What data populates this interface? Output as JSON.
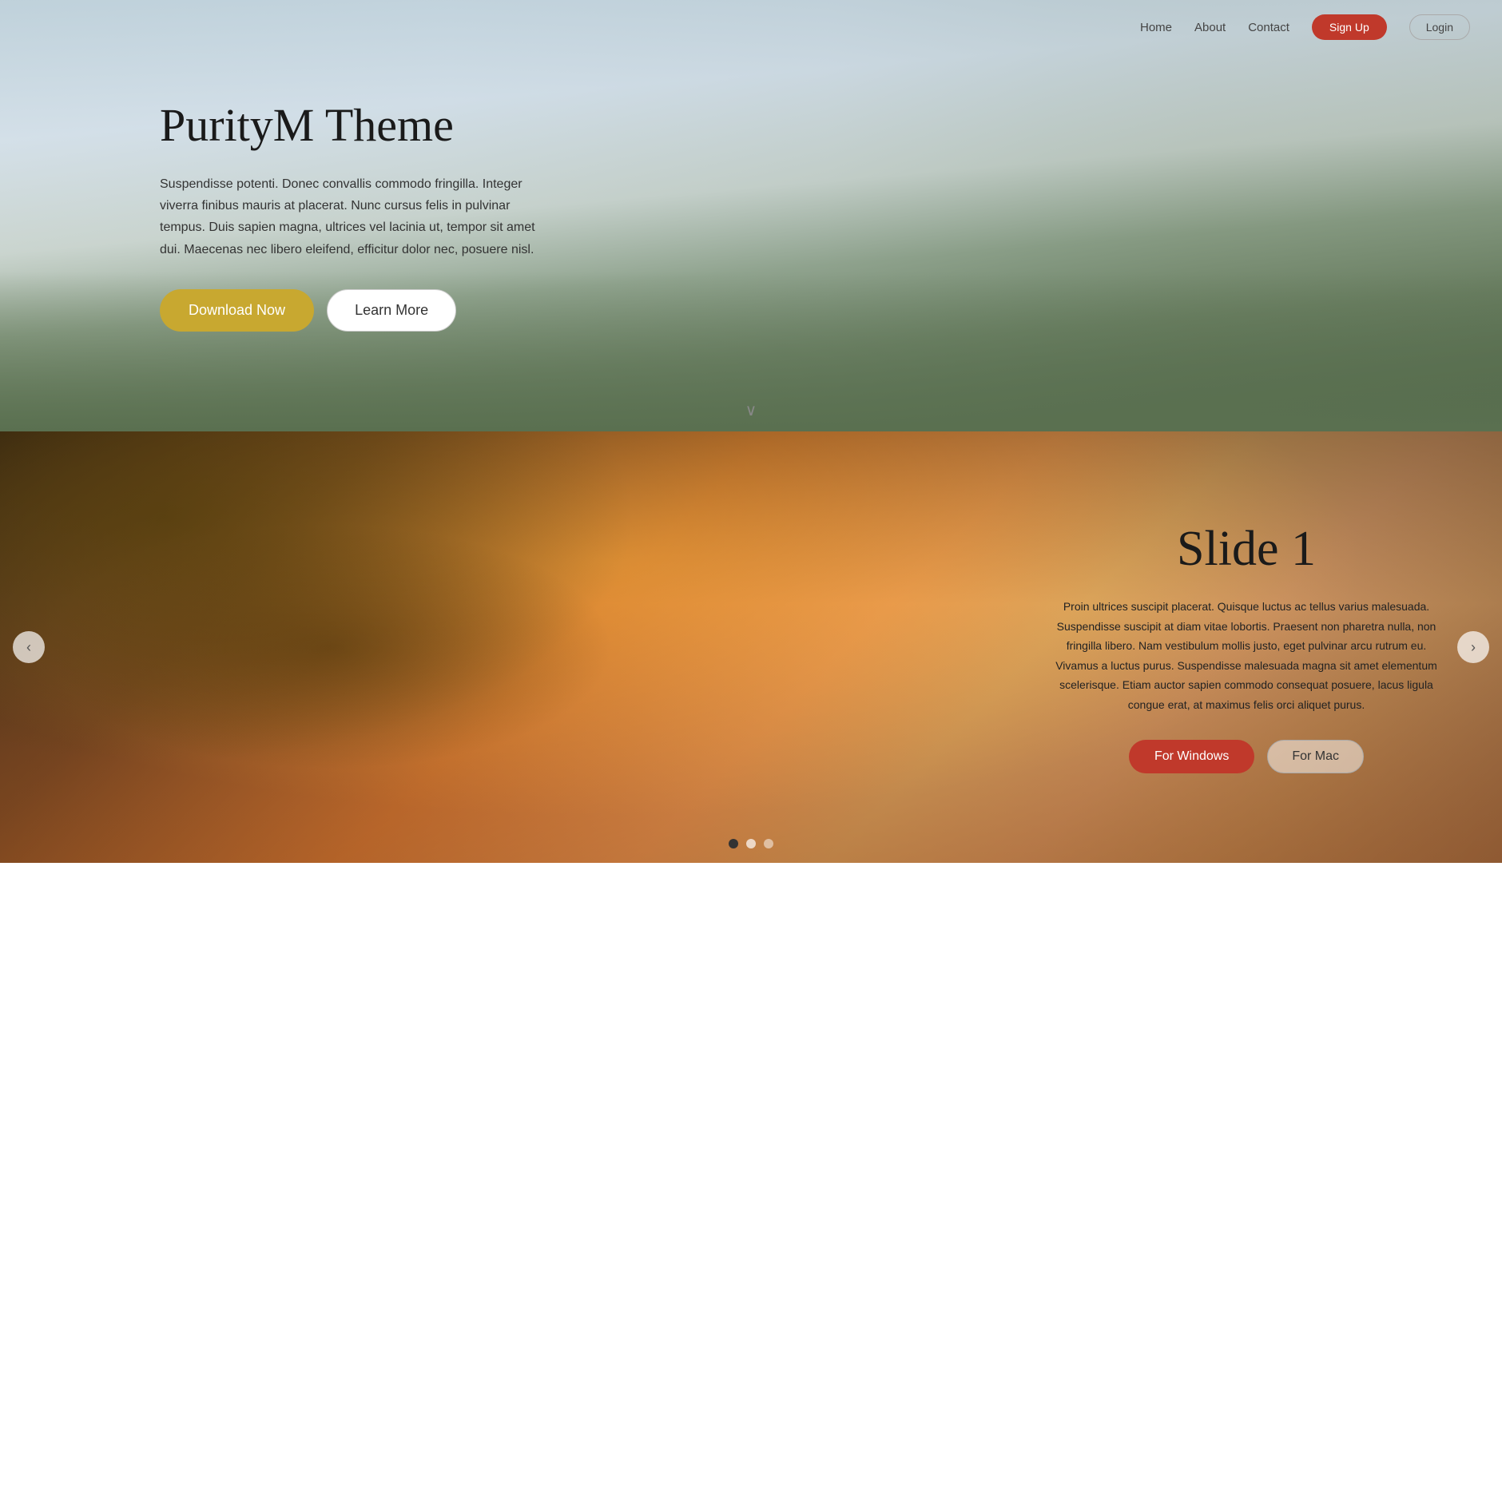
{
  "navbar": {
    "links": [
      {
        "label": "Home",
        "id": "home"
      },
      {
        "label": "About",
        "id": "about"
      },
      {
        "label": "Contact",
        "id": "contact"
      }
    ],
    "signup_label": "Sign Up",
    "login_label": "Login"
  },
  "hero": {
    "title": "PurityM Theme",
    "description": "Suspendisse potenti. Donec convallis commodo fringilla. Integer viverra finibus mauris at placerat. Nunc cursus felis in pulvinar tempus. Duis sapien magna, ultrices vel lacinia ut, tempor sit amet dui. Maecenas nec libero eleifend, efficitur dolor nec, posuere nisl.",
    "btn_download": "Download Now",
    "btn_learn": "Learn More",
    "chevron": "∨"
  },
  "slide": {
    "title": "Slide 1",
    "description": "Proin ultrices suscipit placerat. Quisque luctus ac tellus varius malesuada. Suspendisse suscipit at diam vitae lobortis. Praesent non pharetra nulla, non fringilla libero. Nam vestibulum mollis justo, eget pulvinar arcu rutrum eu. Vivamus a luctus purus. Suspendisse malesuada magna sit amet elementum scelerisque. Etiam auctor sapien commodo consequat posuere, lacus ligula congue erat, at maximus felis orci aliquet purus.",
    "btn_windows": "For Windows",
    "btn_mac": "For Mac",
    "prev_label": "‹",
    "next_label": "›",
    "dots": [
      {
        "active": true
      },
      {
        "active": false
      },
      {
        "active": false
      }
    ]
  }
}
